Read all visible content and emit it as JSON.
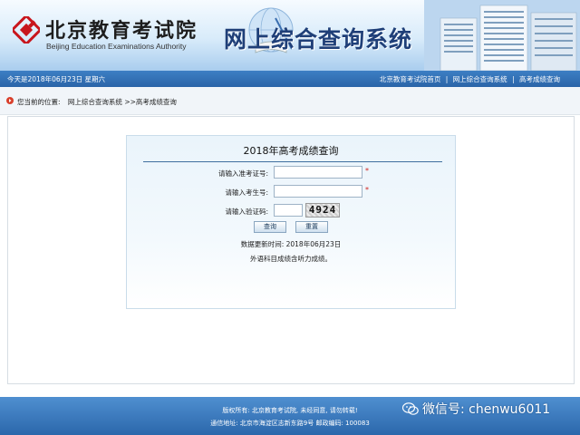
{
  "header": {
    "org_name_cn": "北京教育考试院",
    "org_name_en": "Beijing Education Examinations Authority",
    "site_title": "网上综合查询系统"
  },
  "navbar": {
    "date_text": "今天是2018年06月23日 星期六",
    "links": [
      "北京教育考试院首页",
      "网上综合查询系统",
      "高考成绩查询"
    ],
    "separator": "|"
  },
  "breadcrumb": {
    "prefix": "您当前的位置:",
    "items": [
      "网上综合查询系统",
      ">>高考成绩查询"
    ]
  },
  "form": {
    "title": "2018年高考成绩查询",
    "fields": [
      {
        "label": "请输入准考证号:",
        "value": "",
        "required": "*"
      },
      {
        "label": "请输入考生号:",
        "value": "",
        "required": "*"
      },
      {
        "label": "请输入验证码:",
        "value": ""
      }
    ],
    "captcha_text": "4924",
    "buttons": {
      "query": "查询",
      "reset": "重置"
    },
    "update_time": "数据更新时间: 2018年06月23日",
    "note": "外语科目成绩含听力成绩。"
  },
  "footer": {
    "copyright": "版权所有: 北京教育考试院, 未经同意, 请勿转载!",
    "address": "通信地址: 北京市海淀区志新东路9号 邮政编码: 100083"
  },
  "watermark": {
    "text": "微信号: chenwu6011"
  },
  "colors": {
    "nav_blue": "#2a64a8",
    "title_blue": "#1f3f78",
    "required_red": "#d0201b",
    "logo_red": "#c8161d"
  }
}
